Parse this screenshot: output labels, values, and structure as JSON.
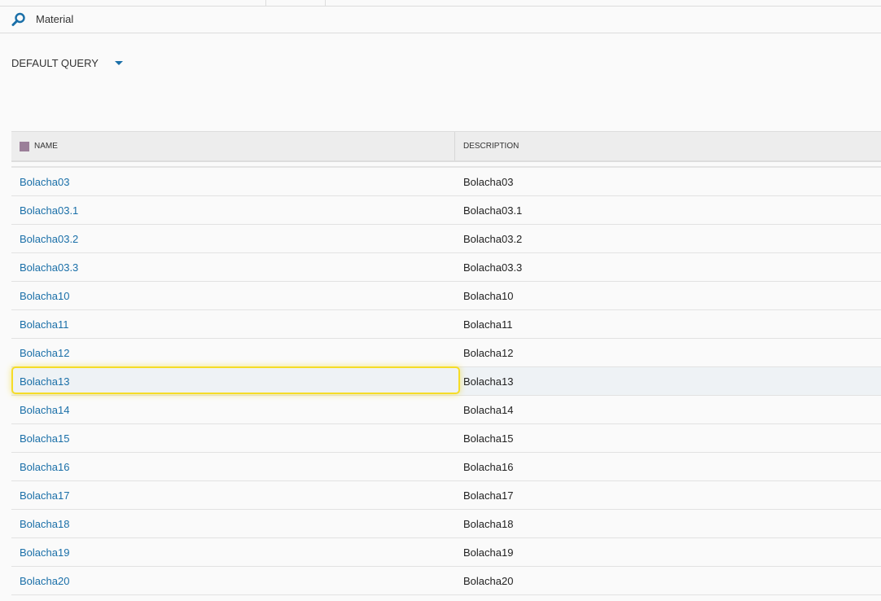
{
  "search": {
    "value": "Material"
  },
  "query": {
    "label": "DEFAULT QUERY"
  },
  "table": {
    "columns": [
      "NAME",
      "DESCRIPTION"
    ],
    "selected_index": 7,
    "rows": [
      {
        "name": "Bolacha03",
        "description": "Bolacha03"
      },
      {
        "name": "Bolacha03.1",
        "description": "Bolacha03.1"
      },
      {
        "name": "Bolacha03.2",
        "description": "Bolacha03.2"
      },
      {
        "name": "Bolacha03.3",
        "description": "Bolacha03.3"
      },
      {
        "name": "Bolacha10",
        "description": "Bolacha10"
      },
      {
        "name": "Bolacha11",
        "description": "Bolacha11"
      },
      {
        "name": "Bolacha12",
        "description": "Bolacha12"
      },
      {
        "name": "Bolacha13",
        "description": "Bolacha13"
      },
      {
        "name": "Bolacha14",
        "description": "Bolacha14"
      },
      {
        "name": "Bolacha15",
        "description": "Bolacha15"
      },
      {
        "name": "Bolacha16",
        "description": "Bolacha16"
      },
      {
        "name": "Bolacha17",
        "description": "Bolacha17"
      },
      {
        "name": "Bolacha18",
        "description": "Bolacha18"
      },
      {
        "name": "Bolacha19",
        "description": "Bolacha19"
      },
      {
        "name": "Bolacha20",
        "description": "Bolacha20"
      }
    ]
  },
  "colors": {
    "accent": "#1a6fa8",
    "focus": "#f5dc28"
  }
}
